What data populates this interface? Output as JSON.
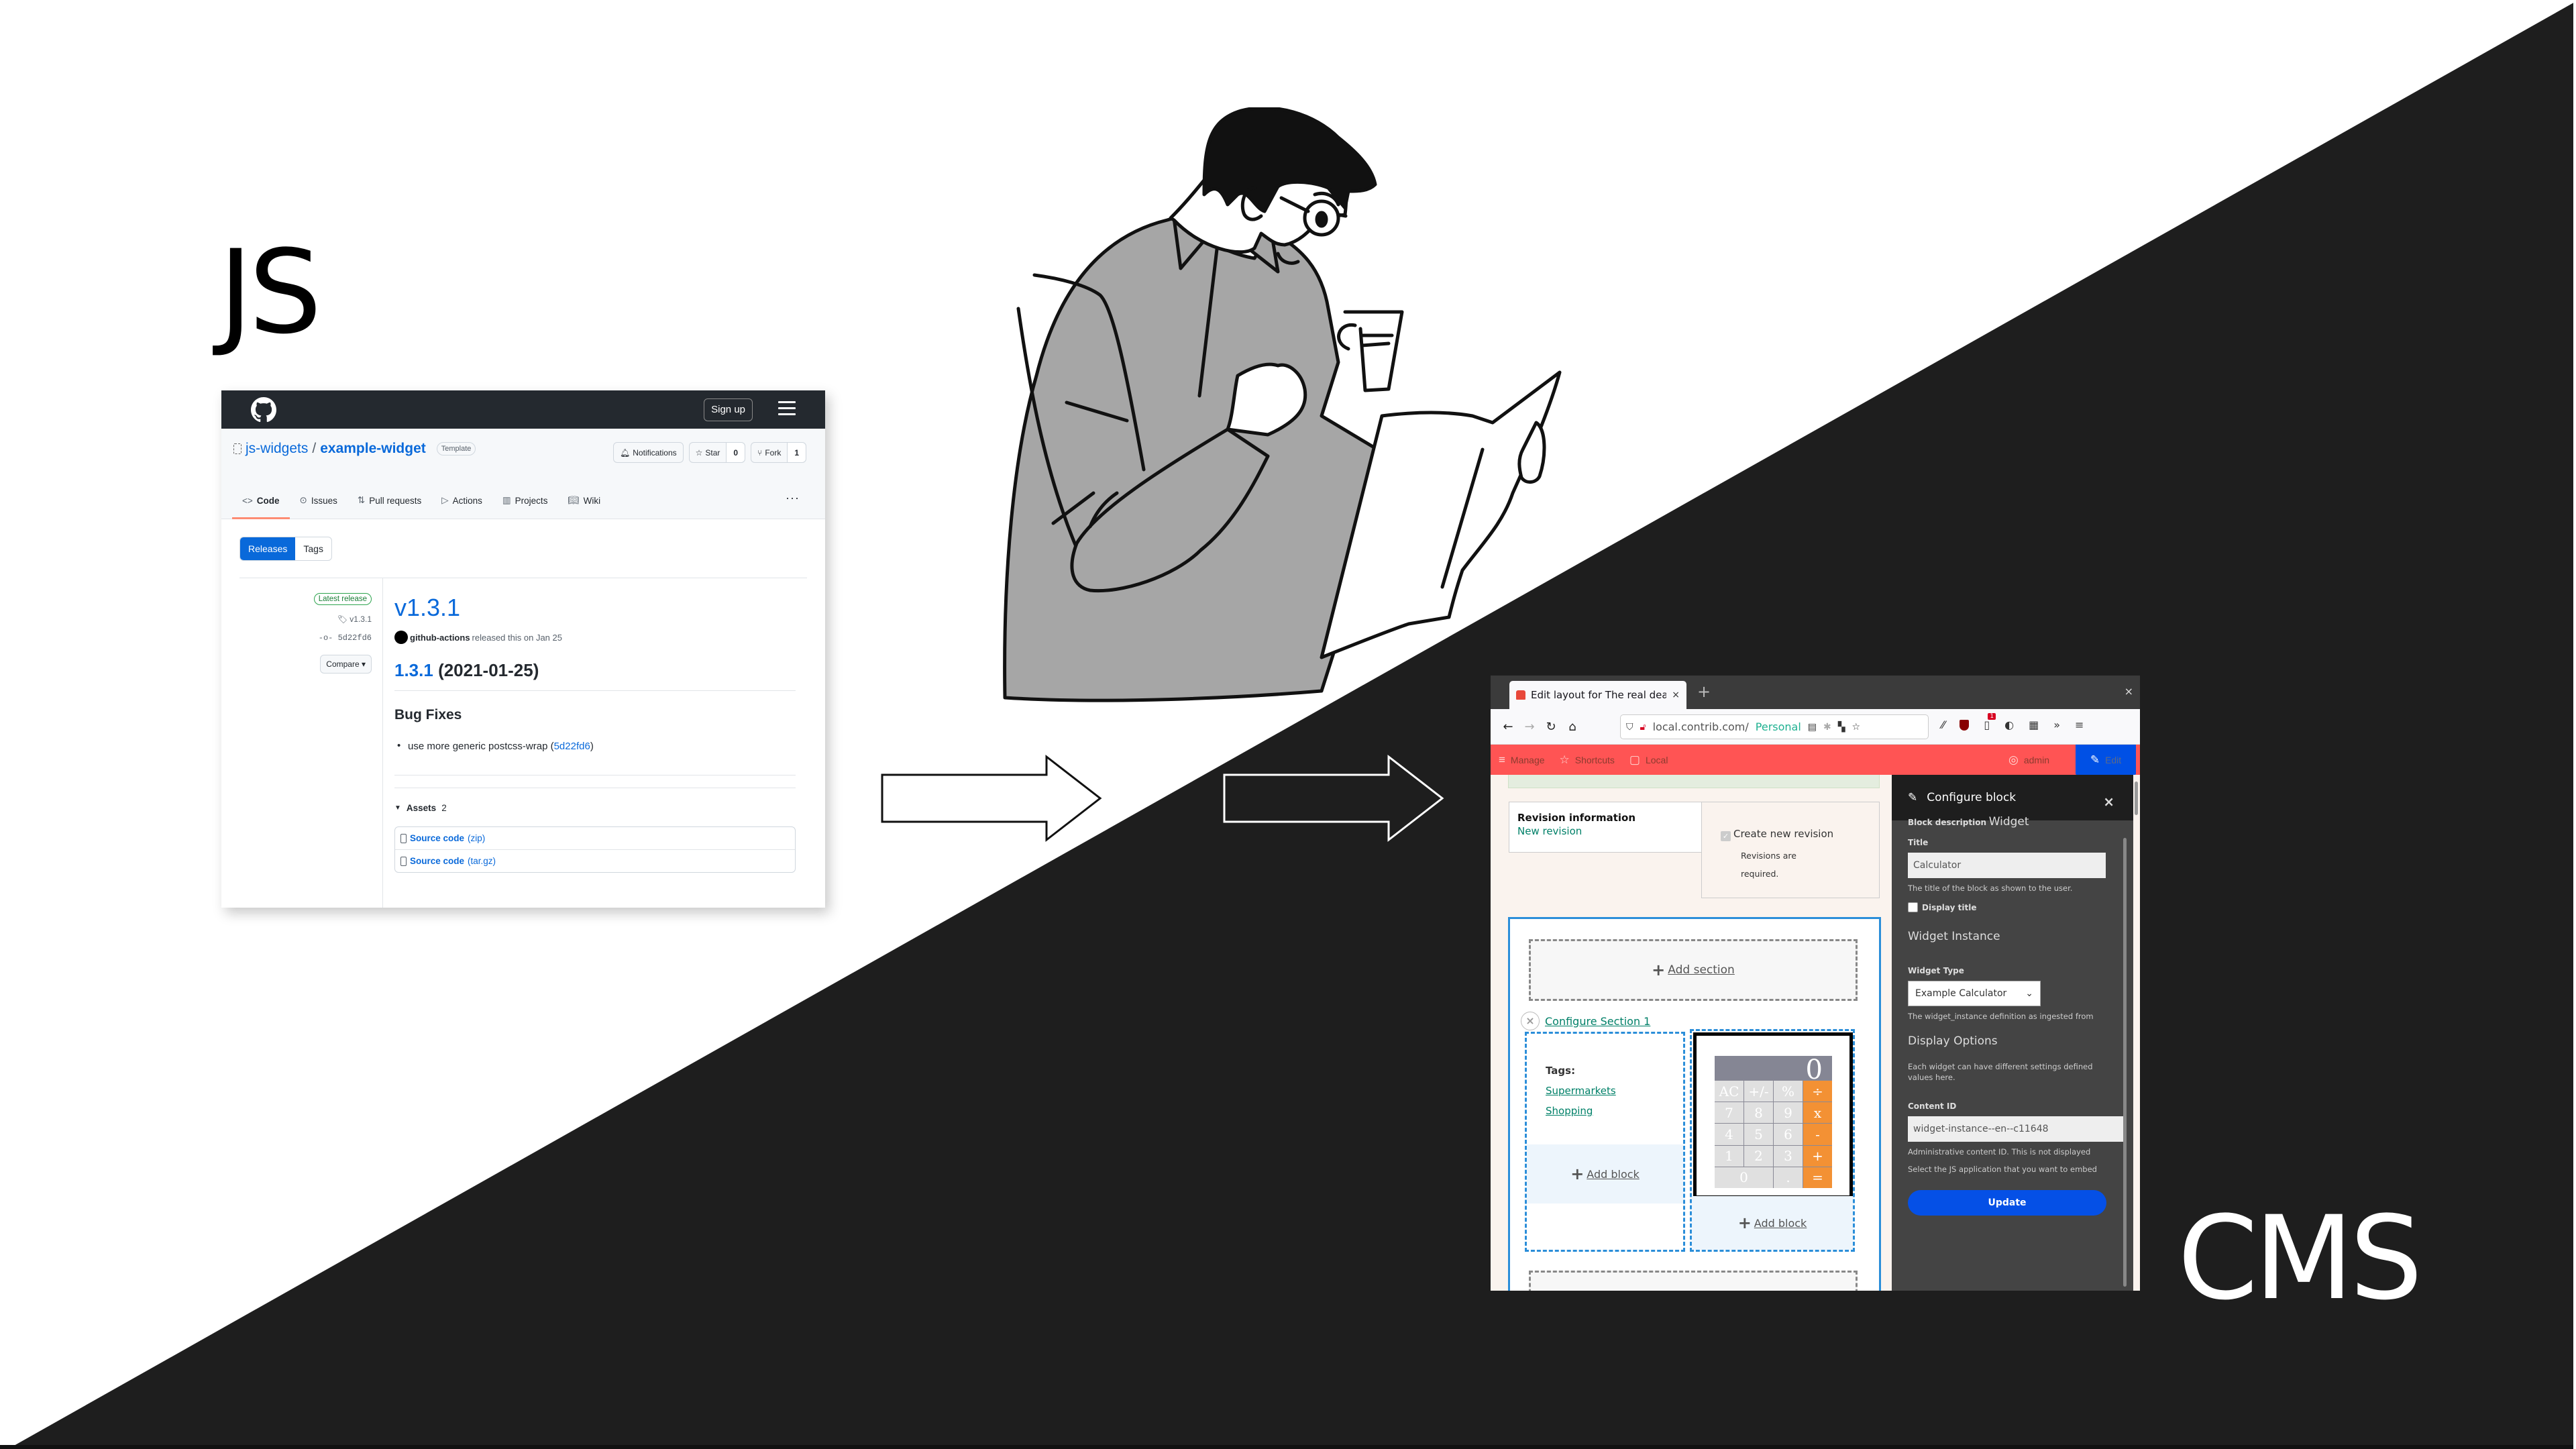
{
  "labels": {
    "left": "JS",
    "right": "CMS"
  },
  "colors": {
    "dark_bg": "#1e1e1e",
    "light_bg": "#ffffff"
  },
  "github": {
    "signup": "Sign up",
    "owner": "js-widgets",
    "separator": "/",
    "repo": "example-widget",
    "template_badge": "Template",
    "notifications": "Notifications",
    "star": "Star",
    "star_count": "0",
    "fork": "Fork",
    "fork_count": "1",
    "tabs": [
      "Code",
      "Issues",
      "Pull requests",
      "Actions",
      "Projects",
      "Wiki"
    ],
    "more": "···",
    "subnav": [
      "Releases",
      "Tags"
    ],
    "latest_badge": "Latest release",
    "tag": "v1.3.1",
    "commit": "5d22fd6",
    "compare": "Compare ▾",
    "version": "v1.3.1",
    "author": "github-actions",
    "released_text": "released this on Jan 25",
    "release_link": "1.3.1",
    "release_date": "(2021-01-25)",
    "section": "Bug Fixes",
    "bullet_text": "use more generic postcss-wrap (",
    "bullet_link": "5d22fd6",
    "bullet_end": ")",
    "assets_label": "Assets",
    "assets_count": "2",
    "assets": [
      {
        "label": "Source code",
        "type": "(zip)"
      },
      {
        "label": "Source code",
        "type": "(tar.gz)"
      }
    ]
  },
  "cms": {
    "browser": {
      "tab_title": "Edit layout for The real deal",
      "tab_close": "×",
      "new_tab": "+",
      "window_close": "×",
      "url_host": "local.contrib.com/",
      "container": "Personal"
    },
    "toolbar": {
      "manage": "Manage",
      "shortcuts": "Shortcuts",
      "local": "Local",
      "user": "admin",
      "edit": "Edit"
    },
    "revision": {
      "title": "Revision information",
      "subtitle": "New revision",
      "checkbox_label": "Create new revision",
      "checkbox_checked": true,
      "description": "Revisions are required."
    },
    "layout": {
      "add_section": "Add section",
      "configure_section": "Configure Section 1",
      "tags_label": "Tags:",
      "tags": [
        "Supermarkets",
        "Shopping"
      ],
      "add_block": "Add block"
    },
    "calculator": {
      "display": "0",
      "keys": [
        "AC",
        "+/-",
        "%",
        "÷",
        "7",
        "8",
        "9",
        "x",
        "4",
        "5",
        "6",
        "-",
        "1",
        "2",
        "3",
        "+",
        "0",
        ".",
        "="
      ],
      "operator_color": "#f39134"
    },
    "sidebar": {
      "title": "Configure block",
      "close": "×",
      "block_description_label": "Block description",
      "block_description_value": "Widget",
      "title_label": "Title",
      "title_value": "Calculator",
      "title_help": "The title of the block as shown to the user.",
      "display_title_label": "Display title",
      "display_title_checked": false,
      "widget_instance_heading": "Widget Instance",
      "widget_type_label": "Widget Type",
      "widget_type_value": "Example Calculator",
      "widget_type_help": "The widget_instance definition as ingested from",
      "display_options_heading": "Display Options",
      "display_options_help": "Each widget can have different settings defined values here.",
      "content_id_label": "Content ID",
      "content_id_value": "widget-instance--en--c11648",
      "content_id_help": "Administrative content ID. This is not displayed",
      "select_help": "Select the JS application that you want to embed",
      "update": "Update"
    }
  }
}
